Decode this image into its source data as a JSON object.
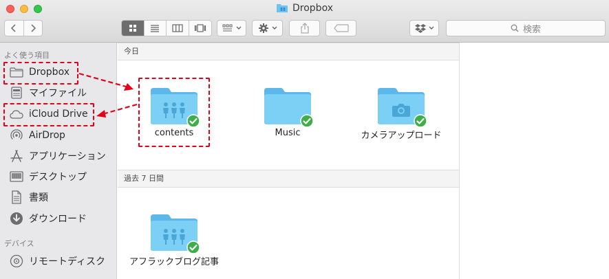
{
  "window": {
    "title": "Dropbox"
  },
  "toolbar": {
    "search_placeholder": "検索",
    "icons": [
      "back-icon",
      "forward-icon",
      "icon-view-icon",
      "list-view-icon",
      "column-view-icon",
      "coverflow-view-icon",
      "arrange-icon",
      "action-gear-icon",
      "share-icon",
      "tags-icon",
      "dropbox-icon"
    ]
  },
  "sidebar": {
    "favorites_heading": "よく使う項目",
    "favorites": [
      {
        "label": "Dropbox",
        "icon": "folder-icon"
      },
      {
        "label": "マイファイル",
        "icon": "all-my-files-icon"
      },
      {
        "label": "iCloud Drive",
        "icon": "cloud-icon"
      },
      {
        "label": "AirDrop",
        "icon": "airdrop-icon"
      },
      {
        "label": "アプリケーション",
        "icon": "applications-icon"
      },
      {
        "label": "デスクトップ",
        "icon": "desktop-icon"
      },
      {
        "label": "書類",
        "icon": "documents-icon"
      },
      {
        "label": "ダウンロード",
        "icon": "downloads-icon"
      }
    ],
    "devices_heading": "デバイス",
    "devices": [
      {
        "label": "リモートディスク",
        "icon": "disc-icon"
      }
    ]
  },
  "main": {
    "sections": [
      {
        "header": "今日",
        "items": [
          {
            "label": "contents",
            "icon": "shared-folder-icon",
            "synced": true
          },
          {
            "label": "Music",
            "icon": "folder-icon",
            "synced": true
          },
          {
            "label": "カメラアップロード",
            "icon": "camera-folder-icon",
            "synced": true
          }
        ]
      },
      {
        "header": "過去 7 日間",
        "items": [
          {
            "label": "アフラックブログ記事",
            "icon": "shared-folder-icon",
            "synced": true
          }
        ]
      }
    ]
  },
  "colors": {
    "annotation": "#e2001a",
    "folder": "#6cc3ef",
    "sync_check": "#3fae49"
  }
}
